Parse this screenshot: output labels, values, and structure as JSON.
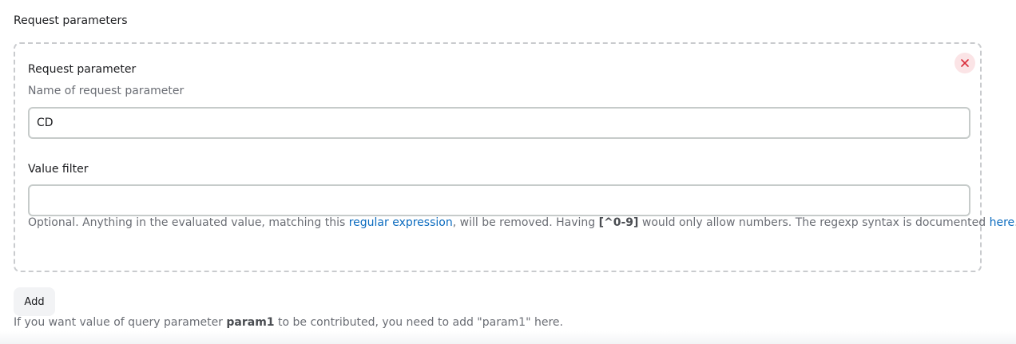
{
  "section": {
    "title": "Request parameters"
  },
  "parameter": {
    "label": "Request parameter",
    "description": "Name of request parameter",
    "value": "CD",
    "remove_icon": "close-icon",
    "remove_color": "#d92d3a"
  },
  "value_filter": {
    "label": "Value filter",
    "value": "",
    "help": {
      "prefix": "Optional. Anything in the evaluated value, matching this ",
      "link_regex": "regular expression",
      "middle": ", will be removed. Having ",
      "example": "[^0-9]",
      "after_example": " would only allow numbers. The regexp syntax is documented ",
      "link_here": "here",
      "suffix": "."
    }
  },
  "add_button": {
    "label": "Add"
  },
  "hint": {
    "prefix": "If you want value of query parameter ",
    "param": "param1",
    "suffix": " to be contributed, you need to add \"param1\" here."
  },
  "colors": {
    "link": "#0b6bbf",
    "muted_text": "#6a6d74",
    "panel_border": "#c9cbce"
  }
}
